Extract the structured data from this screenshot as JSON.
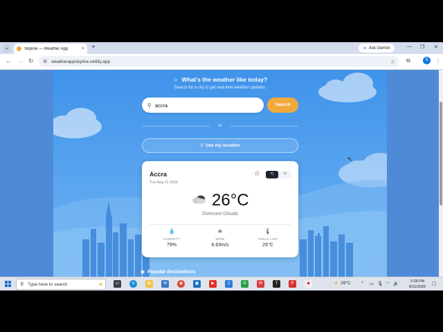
{
  "browser": {
    "tab_title": "Skyline — Weather App",
    "tab_close": "×",
    "new_tab": "+",
    "gemini_label": "Ask Gemini",
    "url": "weatherappskyline.netlify.app",
    "profile_initial": "S",
    "window_controls": [
      "—",
      "❐",
      "✕"
    ]
  },
  "header": {
    "title": "What's the weather like today?",
    "subtitle": "Search for a city to get real-time weather updates."
  },
  "search": {
    "value": "accra",
    "placeholder": "",
    "button_label": "Search"
  },
  "divider_text": "or",
  "location_button": "Use my location",
  "card": {
    "city": "Accra",
    "date": "Tue Aug 11 2026",
    "unit_c": "°C",
    "unit_f": "°F",
    "selected_unit": "°C",
    "temperature": "26°C",
    "condition": "Overcast Clouds",
    "condition_icon": "overcast-clouds-icon",
    "stats": [
      {
        "icon": "droplet-icon",
        "label": "HUMIDITY",
        "value": "79%"
      },
      {
        "icon": "wind-icon",
        "label": "WIND",
        "value": "6.63m/s"
      },
      {
        "icon": "thermometer-icon",
        "label": "FEELS LIKE",
        "value": "26°C"
      }
    ]
  },
  "popular_heading": "Popular destinations",
  "taskbar": {
    "search_placeholder": "Type here to search",
    "weather_temp": "29°C",
    "time": "2:28 PM",
    "date": "8/11/2026"
  },
  "colors": {
    "accent": "#f2a93b",
    "app_bg": "#4a9aee",
    "card_dark": "#1b2330"
  }
}
